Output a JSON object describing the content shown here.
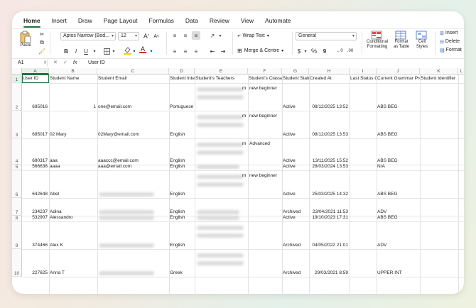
{
  "tabs": [
    "Home",
    "Insert",
    "Draw",
    "Page Layout",
    "Formulas",
    "Data",
    "Review",
    "View",
    "Automate"
  ],
  "ribbon": {
    "paste_label": "Paste",
    "font_name": "Aptos Narrow (Bod...",
    "font_size": "12",
    "increase_font": "A",
    "decrease_font": "A",
    "bold": "B",
    "italic": "I",
    "underline": "U",
    "wrap_text": "Wrap Text",
    "merge_center": "Merge & Centre",
    "number_format": "General",
    "currency": "$",
    "percent": "%",
    "comma": "9",
    "cond_format_l1": "Conditional",
    "cond_format_l2": "Formatting",
    "format_table_l1": "Format",
    "format_table_l2": "as Table",
    "cell_styles_l1": "Cell",
    "cell_styles_l2": "Styles",
    "insert": "Insert",
    "delete": "Delete",
    "format": "Format"
  },
  "formula_bar": {
    "name_box": "A1",
    "fx": "fx",
    "value": "User ID"
  },
  "columns": [
    "A",
    "B",
    "C",
    "D",
    "E",
    "F",
    "G",
    "H",
    "I",
    "J",
    "K",
    "L"
  ],
  "headers": [
    "User ID",
    "Student Name",
    "Student Email",
    "Student Interface Language",
    "Student's Teachers",
    "Student's Classes",
    "Student Status",
    "Created At",
    "Last Status Change",
    "Current Grammar Progress",
    "Student Identifier",
    ""
  ],
  "row_numbers": [
    "1",
    "2",
    "3",
    "4",
    "5",
    "6",
    "7",
    "8",
    "9",
    "10"
  ],
  "rows": [
    {
      "id": "695016",
      "name": "1",
      "email": "one@email.com",
      "lang": "Portuguese",
      "class": "new beginner",
      "class_suffix": "m",
      "status": "Active",
      "created": "08/12/2025 13:52",
      "grammar": "ABS BEG"
    },
    {
      "id": "695017",
      "name": "02 Mary",
      "email": "02Mary@email.com",
      "lang": "English",
      "class": "new beginner",
      "class_suffix": "m",
      "status": "Active",
      "created": "08/12/2025 13:53",
      "grammar": "ABS BEG"
    },
    {
      "id": "690317",
      "name": "aaa",
      "email": "aaaccc@email.com",
      "lang": "English",
      "class": "Advanced",
      "class_suffix": "m",
      "status": "Active",
      "created": "13/11/2025 15:52",
      "grammar": "ABS BEG"
    },
    {
      "id": "566636",
      "name": "aaaa",
      "email": "aaa@email.com",
      "lang": "English",
      "class": "",
      "class_suffix": "",
      "status": "Active",
      "created": "28/03/2024 13:53",
      "grammar": "N/A"
    },
    {
      "id": "642648",
      "name": "Abel",
      "email": "",
      "lang": "English",
      "class": "new beginner",
      "class_suffix": "m",
      "status": "Active",
      "created": "25/03/2025 14:32",
      "grammar": "ABS BEG"
    },
    {
      "id": "234237",
      "name": "Adina",
      "email": "",
      "lang": "English",
      "class": "",
      "class_suffix": "",
      "status": "Archived",
      "created": "23/04/2021 11:53",
      "grammar": "ADV"
    },
    {
      "id": "532907",
      "name": "Alessandro",
      "email": "",
      "lang": "English",
      "class": "",
      "class_suffix": "",
      "status": "Active",
      "created": "19/10/2023 17:31",
      "grammar": "ABS BEG"
    },
    {
      "id": "374466",
      "name": "Alex K",
      "email": "",
      "lang": "English",
      "class": "",
      "class_suffix": "",
      "status": "Archived",
      "created": "04/05/2022 21:01",
      "grammar": "ADV"
    },
    {
      "id": "227625",
      "name": "Anna T",
      "email": "",
      "lang": "Greek",
      "class": "",
      "class_suffix": "",
      "status": "Archived",
      "created": "29/03/2021 8:59",
      "grammar": "UPPER INT"
    }
  ],
  "colors": {
    "accent": "#1e7145",
    "font_color": "#d92d20",
    "highlight": "#f5d20a"
  }
}
